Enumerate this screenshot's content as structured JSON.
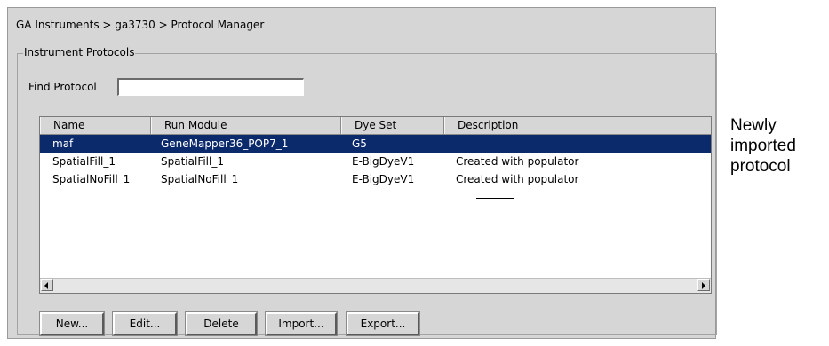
{
  "header": {
    "breadcrumb": "GA Instruments > ga3730 > Protocol Manager"
  },
  "group": {
    "title": "Instrument Protocols"
  },
  "find": {
    "label": "Find Protocol",
    "value": ""
  },
  "table": {
    "columns": [
      "Name",
      "Run Module",
      "Dye Set",
      "Description"
    ],
    "rows": [
      [
        "maf",
        "GeneMapper36_POP7_1",
        "G5",
        ""
      ],
      [
        "SpatialFill_1",
        "SpatialFill_1",
        "E-BigDyeV1",
        "Created with populator"
      ],
      [
        "SpatialNoFill_1",
        "SpatialNoFill_1",
        "E-BigDyeV1",
        "Created with populator"
      ]
    ],
    "selected_row": 0
  },
  "buttons": {
    "new": "New...",
    "edit": "Edit...",
    "delete": "Delete",
    "import": "Import...",
    "export": "Export..."
  },
  "callout": {
    "line1": "Newly",
    "line2": "imported",
    "line3": "protocol"
  },
  "colors": {
    "panel": "#d6d6d6",
    "selection": "#0b2a6b"
  },
  "icons": {
    "scroll_left": "arrow-left-icon",
    "scroll_right": "arrow-right-icon"
  }
}
